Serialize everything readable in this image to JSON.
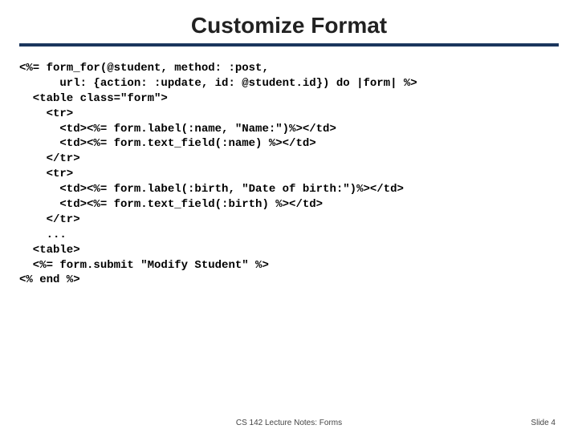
{
  "title": "Customize Format",
  "code_lines": [
    "<%= form_for(@student, method: :post,",
    "      url: {action: :update, id: @student.id}) do |form| %>",
    "  <table class=\"form\">",
    "    <tr>",
    "      <td><%= form.label(:name, \"Name:\")%></td>",
    "      <td><%= form.text_field(:name) %></td>",
    "    </tr>",
    "    <tr>",
    "      <td><%= form.label(:birth, \"Date of birth:\")%></td>",
    "      <td><%= form.text_field(:birth) %></td>",
    "    </tr>",
    "    ...",
    "  <table>",
    "  <%= form.submit \"Modify Student\" %>",
    "<% end %>"
  ],
  "footer_center": "CS 142 Lecture Notes: Forms",
  "footer_right": "Slide 4"
}
